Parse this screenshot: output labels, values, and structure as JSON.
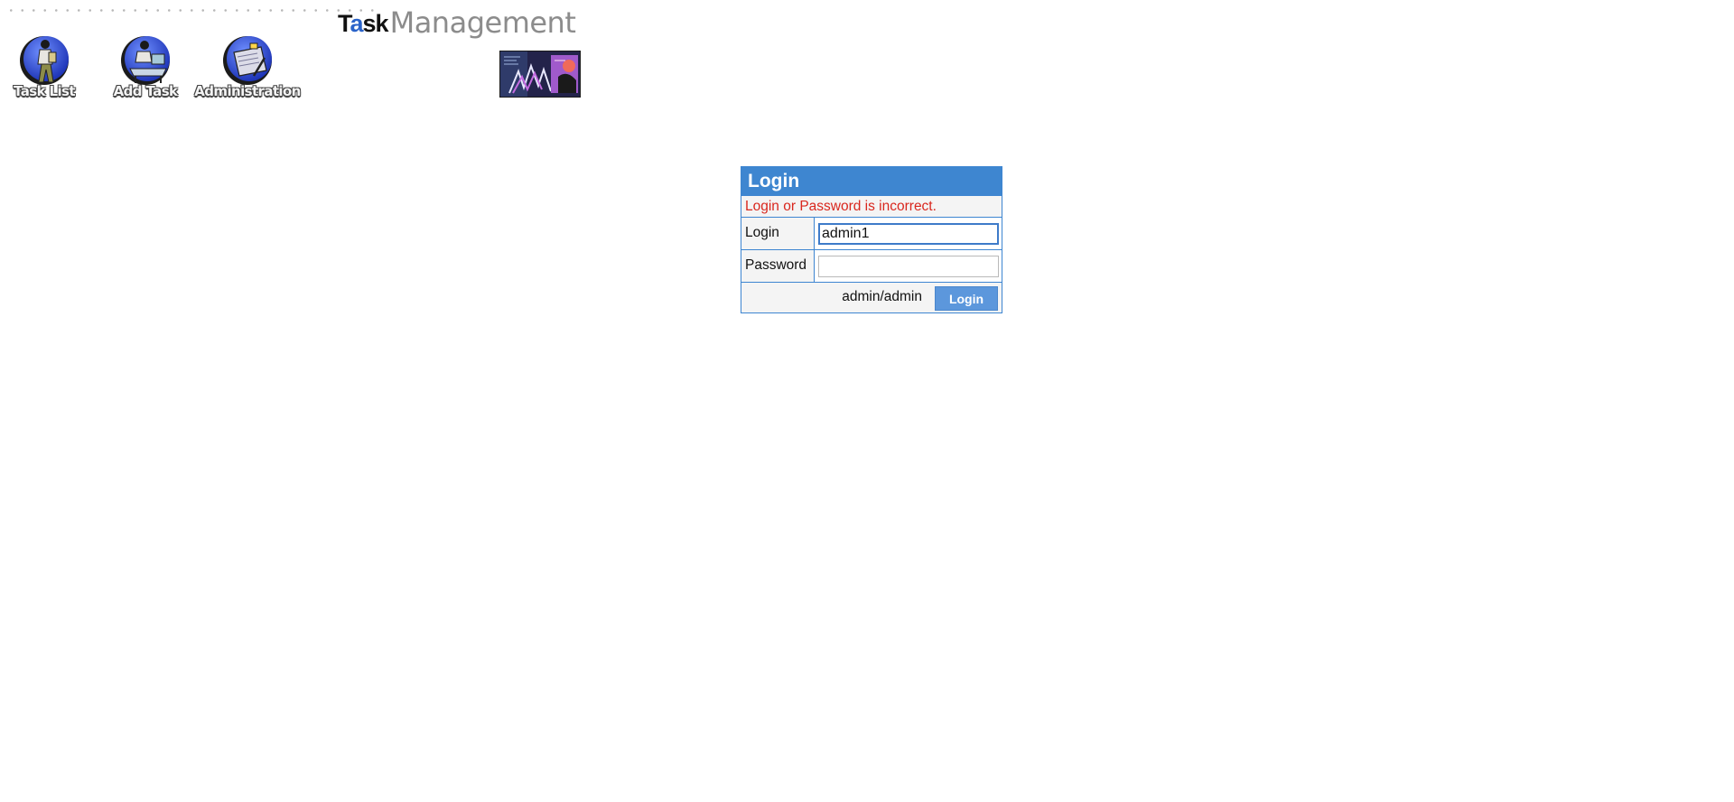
{
  "header": {
    "brand": {
      "part_1": "T",
      "part_a": "a",
      "part_2": "sk",
      "part_3": "Management"
    },
    "nav": [
      {
        "label": "Task List",
        "icon": "person-with-notepad-icon"
      },
      {
        "label": "Add Task",
        "icon": "person-at-desk-icon"
      },
      {
        "label": "Administration",
        "icon": "notepad-with-pen-icon"
      }
    ],
    "banner_icon": "promo-banner-image"
  },
  "login": {
    "title": "Login",
    "error": "Login or Password is incorrect.",
    "login_label": "Login",
    "login_value": "admin1",
    "password_label": "Password",
    "password_value": "",
    "hint": "admin/admin",
    "button": "Login"
  },
  "colors": {
    "header_blue": "#3e86d0",
    "error_red": "#d9271e",
    "button_blue": "#5c97dc"
  }
}
